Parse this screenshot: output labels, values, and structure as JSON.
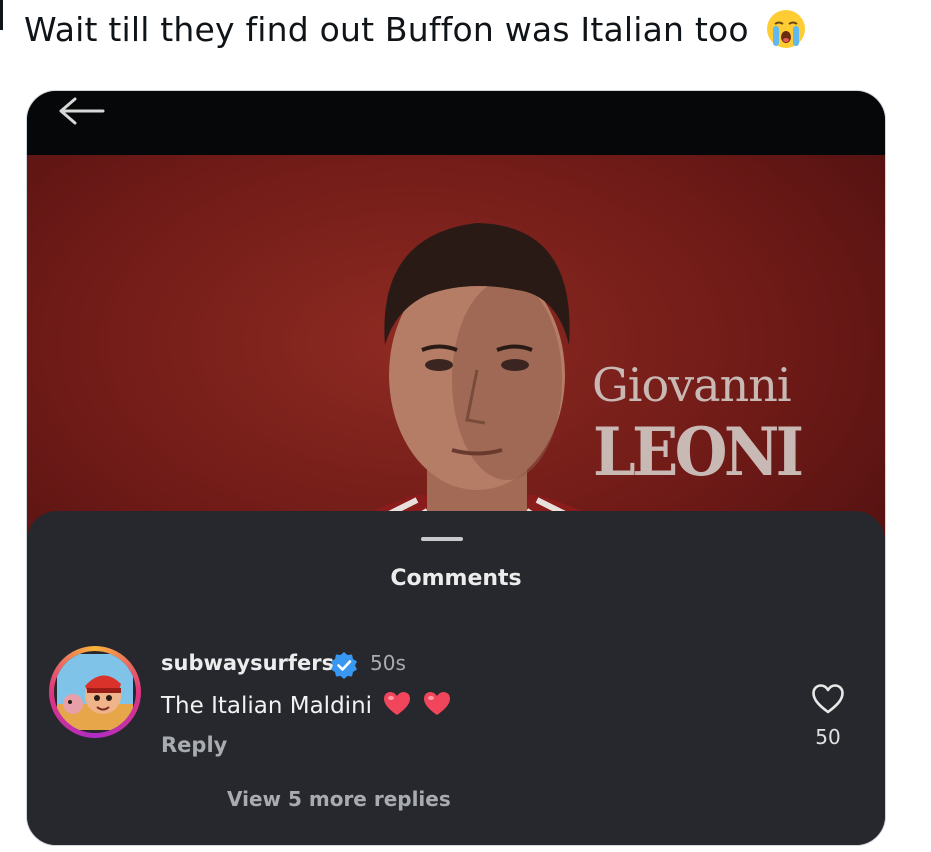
{
  "tweet": {
    "text": "Wait till they find out Buffon was Italian too",
    "emoji": "loudly-crying-face"
  },
  "post": {
    "player_first_name": "Giovanni",
    "player_last_name": "LEONI"
  },
  "comments_sheet": {
    "title": "Comments",
    "comment": {
      "username": "subwaysurfers",
      "verified": true,
      "time": "50s",
      "text": "The Italian Maldini",
      "emojis": "two red hearts",
      "reply_label": "Reply",
      "like_count": "50"
    },
    "view_replies": "View 5 more replies"
  },
  "colors": {
    "verified_badge": "#3897f0",
    "sheet_bg": "#26282d",
    "photo_bg": "#6e1a17"
  }
}
